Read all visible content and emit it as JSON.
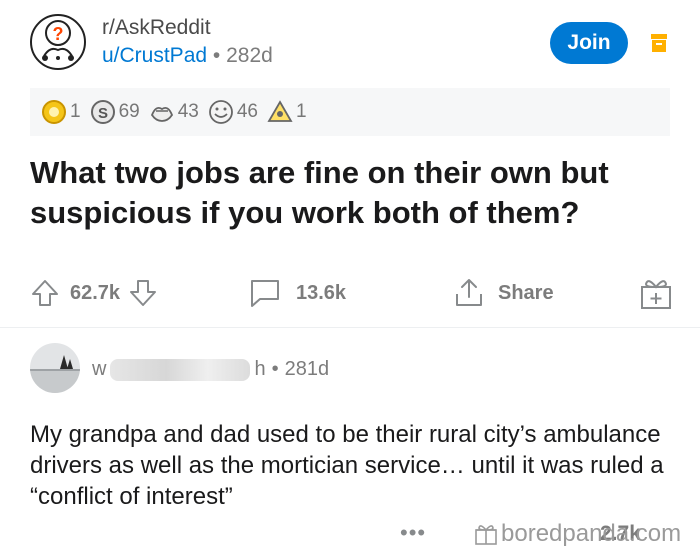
{
  "post": {
    "subreddit": "r/AskReddit",
    "author": "u/CrustPad",
    "separator": "•",
    "age": "282d",
    "join_label": "Join",
    "title": "What two jobs are fine on their own but suspicious if you work both of them?",
    "awards": [
      {
        "icon": "gold-award-icon",
        "count": "1"
      },
      {
        "icon": "silver-award-icon",
        "count": "69"
      },
      {
        "icon": "hugz-award-icon",
        "count": "43"
      },
      {
        "icon": "wholesome-award-icon",
        "count": "46"
      },
      {
        "icon": "rocket-award-icon",
        "count": "1"
      }
    ],
    "upvotes": "62.7k",
    "comments": "13.6k",
    "share_label": "Share"
  },
  "comment": {
    "name_start": "w",
    "name_end": "h",
    "separator": "•",
    "age": "281d",
    "body": "My grandpa and dad used to be their rural city’s ambulance drivers as well as the mortician service… until it was ruled a “conflict of interest”",
    "more": "•••",
    "votes": "2.7k"
  },
  "watermark": "boredpanda.com",
  "colors": {
    "accent": "#0079d3",
    "archive": "#ffb000",
    "meta_gray": "#7c7c7c"
  }
}
